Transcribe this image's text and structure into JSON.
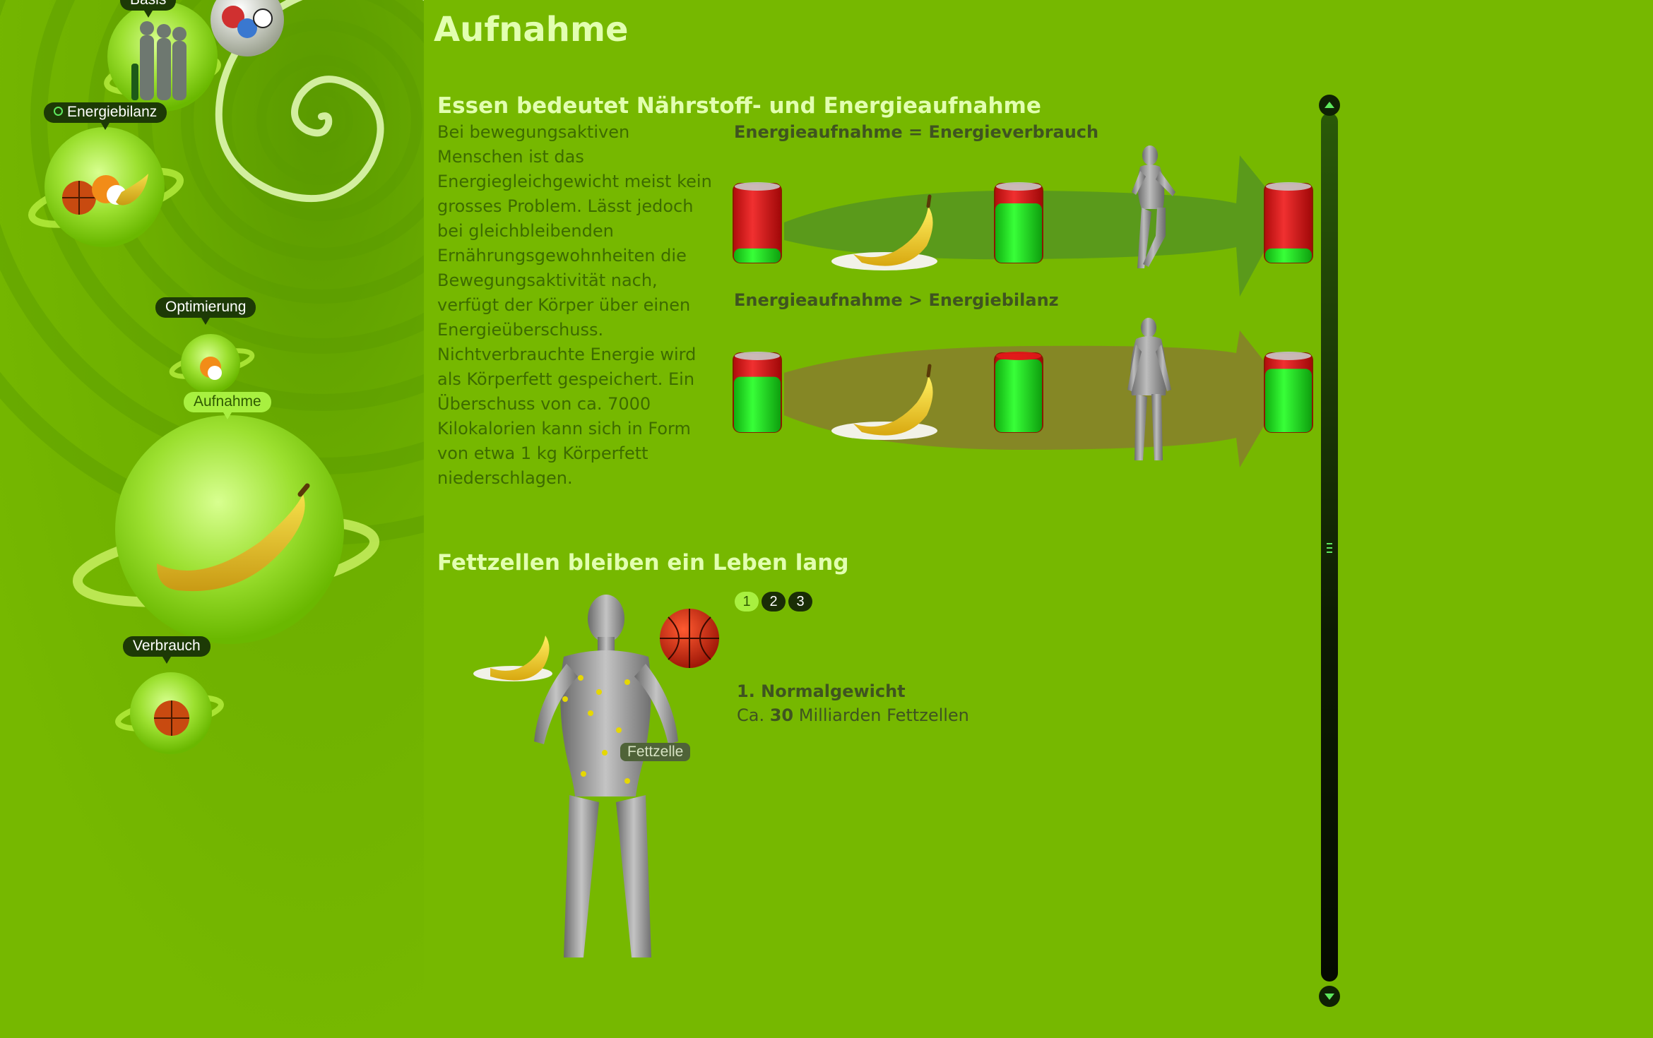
{
  "nav": {
    "basis": "Basis",
    "energiebilanz": "Energiebilanz",
    "optimierung": "Optimierung",
    "aufnahme": "Aufnahme",
    "verbrauch": "Verbrauch"
  },
  "page": {
    "title": "Aufnahme"
  },
  "section1": {
    "title": "Essen bedeutet Nährstoff- und Energieaufnahme",
    "intro": "Bei bewegungsaktiven Menschen ist das Energiegleichgewicht meist kein grosses Problem. Lässt jedoch bei gleichbleibenden Ernährungsgewohnheiten die Bewegungsaktivität nach, verfügt der Körper über einen Energieüberschuss. Nichtverbrauchte Energie wird als Körperfett gespeichert. Ein Überschuss von ca. 7000 Kilokalorien kann sich in Form von etwa 1 kg Körperfett niederschlagen.",
    "diagram1": {
      "heading": "Energieaufnahme = Energieverbrauch",
      "battery_levels": [
        0.18,
        0.75,
        0.18
      ]
    },
    "diagram2": {
      "heading": "Energieaufnahme > Energiebilanz",
      "battery_levels": [
        0.7,
        0.92,
        0.8
      ]
    }
  },
  "section2": {
    "title": "Fettzellen bleiben ein Leben lang",
    "tabs": [
      "1",
      "2",
      "3"
    ],
    "active_tab": "1",
    "subtitle": "1. Normalgewicht",
    "desc_prefix": "Ca. ",
    "desc_number": "30",
    "desc_suffix": " Milliarden Fettzellen",
    "fat_label": "Fettzelle"
  },
  "colors": {
    "background": "#76b800",
    "title": "#e2ffb0",
    "battery_empty": "#e01818",
    "battery_full": "#22ee22"
  }
}
